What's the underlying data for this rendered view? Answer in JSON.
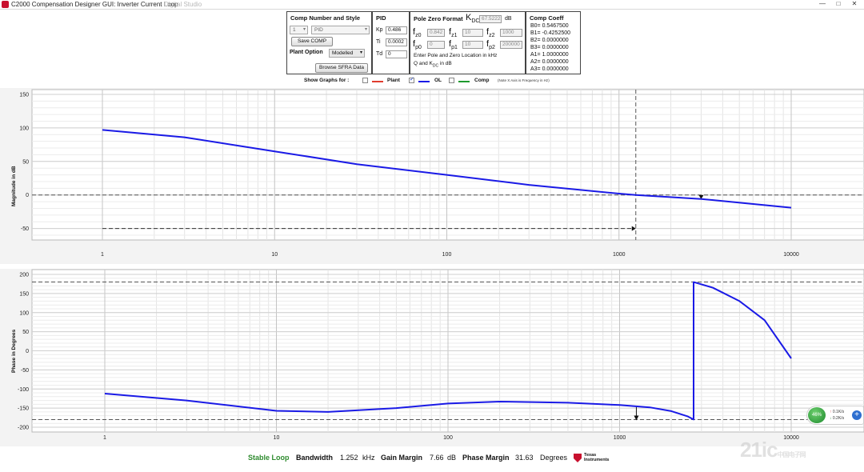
{
  "window": {
    "title": "C2000 Compensation Designer GUI: Inverter Current Loop",
    "title_ghost": "Digital Studio",
    "min_label": "—",
    "max_label": "□",
    "close_label": "✕"
  },
  "comp_panel": {
    "title": "Comp Number and Style",
    "comp_number": "1",
    "comp_style": "PID",
    "save_button": "Save COMP",
    "plant_option_label": "Plant Option",
    "plant_option_value": "Modelled",
    "browse_button": "Browse SFRA Data"
  },
  "pid_panel": {
    "title": "PID",
    "kp_label": "Kp",
    "kp_value": "0.486",
    "ti_label": "Ti",
    "ti_value": "0.0002",
    "td_label": "Td",
    "td_value": "0"
  },
  "pz_panel": {
    "title": "Pole Zero Format",
    "kdc_symbol": "K",
    "kdc_sub": "DC",
    "kdc_value": "67.5222",
    "kdc_unit": "dB",
    "f_sym": "f",
    "fz0_sub": "z0",
    "fz0_value": "0.842",
    "fz1_sub": "z1",
    "fz1_value": "10",
    "fz2_sub": "z2",
    "fz2_value": "1000",
    "fp0_sub": "p0",
    "fp0_value": "0",
    "fp1_sub": "p1",
    "fp1_value": "10",
    "fp2_sub": "p2",
    "fp2_value": "200000",
    "note_line1": "Enter Pole and Zero Location in kHz",
    "note_line2a": "Q and K",
    "note_line2_sub": "DC",
    "note_line2b": " in dB"
  },
  "coeff_panel": {
    "title": "Comp Coeff",
    "lines": [
      "B0= 0.5467500",
      "B1= -0.4252500",
      "B2= 0.0000000",
      "B3= 0.0000000",
      "A1= 1.0000000",
      "A2= 0.0000000",
      "A3= 0.0000000"
    ]
  },
  "show_graphs": {
    "label": "Show Graphs for :",
    "plant_label": "Plant",
    "plant_checked": false,
    "plant_color": "#e03c2e",
    "ol_label": "OL",
    "ol_checked": true,
    "ol_color": "#1a1ae6",
    "comp_label": "Comp",
    "comp_checked": false,
    "comp_color": "#1e9a2e",
    "note": "(Note X Axis is Frequency in Hz)"
  },
  "chart_data": [
    {
      "type": "line",
      "ylabel": "Magnitude in dB",
      "xscale": "log",
      "xlim": [
        1,
        10000
      ],
      "ylim": [
        -60,
        150
      ],
      "xticks": [
        "1",
        "10",
        "100",
        "1000",
        "10000"
      ],
      "yticks": [
        "150",
        "100",
        "50",
        "0",
        "-50"
      ],
      "grid": true,
      "series": [
        {
          "name": "OL",
          "color": "#1a1ae6",
          "x": [
            1,
            3,
            10,
            30,
            100,
            300,
            1000,
            1252,
            3000,
            10000
          ],
          "y": [
            97,
            86,
            65,
            46,
            30,
            15,
            2,
            0,
            -6,
            -19
          ]
        }
      ],
      "annotations": {
        "crossover_freq": 1252,
        "zero_db_line": 0,
        "marker_freq": 3000
      }
    },
    {
      "type": "line",
      "ylabel": "Phase in Degrees",
      "xscale": "log",
      "xlim": [
        1,
        10000
      ],
      "ylim": [
        -200,
        200
      ],
      "xticks": [
        "1",
        "10",
        "100",
        "1000",
        "10000"
      ],
      "yticks": [
        "200",
        "150",
        "100",
        "50",
        "0",
        "-50",
        "-100",
        "-150",
        "-200"
      ],
      "grid": true,
      "series": [
        {
          "name": "OL",
          "color": "#1a1ae6",
          "x": [
            1,
            3,
            10,
            20,
            50,
            100,
            200,
            500,
            1000,
            1500,
            2000,
            2500,
            2700,
            2700,
            3500,
            5000,
            7000,
            10000
          ],
          "y": [
            -112,
            -130,
            -157,
            -160,
            -150,
            -138,
            -133,
            -136,
            -142,
            -148,
            -158,
            -172,
            -180,
            180,
            165,
            130,
            80,
            -20
          ]
        }
      ],
      "annotations": {
        "ref_lines": [
          180,
          -180
        ],
        "marker_freq": 1252
      }
    }
  ],
  "status": {
    "stable_label": "Stable Loop",
    "stable_color": "#2e8b2e",
    "bandwidth_label": "Bandwidth",
    "bandwidth_value": "1.252",
    "bandwidth_unit": "kHz",
    "gm_label": "Gain Margin",
    "gm_value": "7.66",
    "gm_unit": "dB",
    "pm_label": "Phase Margin",
    "pm_value": "31.63",
    "pm_unit": "Degrees",
    "ti_line1": "Texas",
    "ti_line2": "Instruments"
  },
  "overlay": {
    "net_percent": "46%",
    "up_rate": "0.1K/s",
    "down_rate": "0.2K/s",
    "up_arrow": "↑",
    "down_arrow": "↓",
    "plus": "+",
    "watermark": "21ic",
    "watermark_sub": "中国电子网"
  }
}
